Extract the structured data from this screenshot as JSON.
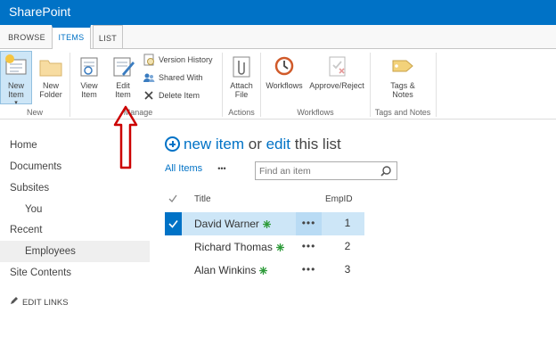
{
  "suite": {
    "brand": "SharePoint"
  },
  "tabs": [
    {
      "label": "BROWSE"
    },
    {
      "label": "ITEMS",
      "selected": true
    },
    {
      "label": "LIST"
    }
  ],
  "ribbon": {
    "new": {
      "new_item_l1": "New",
      "new_item_l2": "Item",
      "new_folder_l1": "New",
      "new_folder_l2": "Folder",
      "group": "New"
    },
    "manage": {
      "view_item_l1": "View",
      "view_item_l2": "Item",
      "edit_item_l1": "Edit",
      "edit_item_l2": "Item",
      "version_history": "Version History",
      "shared_with": "Shared With",
      "delete_item": "Delete Item",
      "group": "Manage"
    },
    "actions": {
      "attach_l1": "Attach",
      "attach_l2": "File",
      "group": "Actions"
    },
    "workflows": {
      "workflows": "Workflows",
      "approve_reject": "Approve/Reject",
      "group": "Workflows"
    },
    "tags": {
      "tags_l1": "Tags &",
      "tags_l2": "Notes",
      "group": "Tags and Notes"
    }
  },
  "nav": {
    "items": [
      {
        "label": "Home"
      },
      {
        "label": "Documents"
      },
      {
        "label": "Subsites"
      },
      {
        "label": "You"
      },
      {
        "label": "Recent"
      },
      {
        "label": "Employees",
        "selected": true
      },
      {
        "label": "Site Contents"
      }
    ],
    "edit_links": "EDIT LINKS"
  },
  "main": {
    "new_item": "new item",
    "or": " or ",
    "edit": "edit",
    "this_list": " this list",
    "view_all": "All Items",
    "view_more": "•••",
    "search_placeholder": "Find an item",
    "columns": {
      "title": "Title",
      "empid": "EmpID"
    },
    "rows": [
      {
        "title": "David Warner",
        "empid": "1",
        "selected": true
      },
      {
        "title": "Richard Thomas",
        "empid": "2"
      },
      {
        "title": "Alan Winkins",
        "empid": "3"
      }
    ],
    "ellipsis": "•••"
  },
  "colors": {
    "brand": "#0072c6",
    "selection": "#cde6f7",
    "arrow": "#cc0000",
    "new_mark": "#2e9b3a"
  }
}
